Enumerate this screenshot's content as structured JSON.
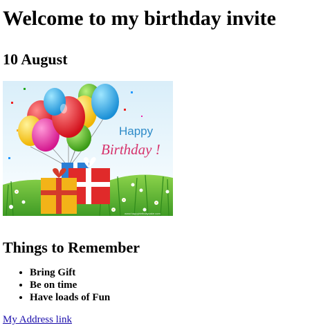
{
  "heading": "Welcome to my birthday invite",
  "date": "10 August",
  "image": {
    "banner_happy": "Happy",
    "banner_birthday": "Birthday !",
    "watermark": "www.happybirthdaycake.com"
  },
  "section_title": "Things to Remember",
  "list_items": [
    "Bring Gift",
    "Be on time",
    "Have loads of Fun"
  ],
  "link_text": "My Address link",
  "colors": {
    "link": "#1a0dab",
    "sky_top": "#bfe3f5",
    "grass": "#4caf32",
    "happy_text": "#2e8bc8",
    "birthday_text": "#d6336c"
  }
}
